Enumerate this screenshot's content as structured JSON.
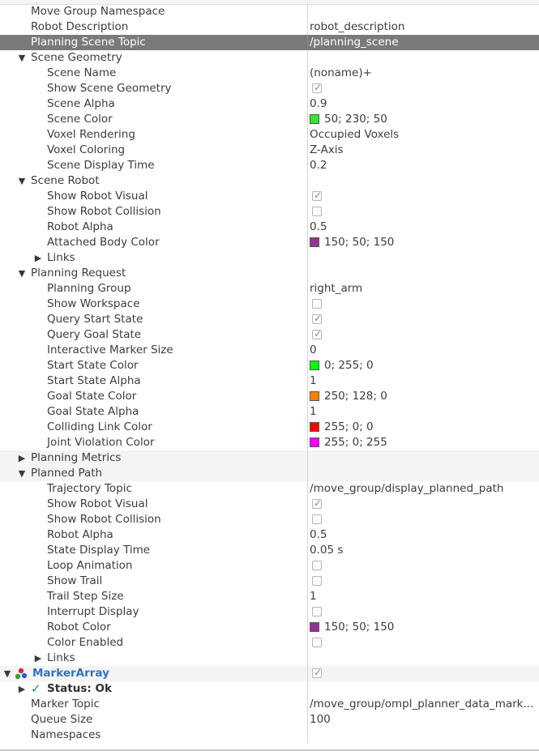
{
  "rows": [
    {
      "kind": "prop",
      "depth": 2,
      "name": "Move Group Namespace",
      "val": {
        "t": "text",
        "text": ""
      },
      "alt": false
    },
    {
      "kind": "prop",
      "depth": 2,
      "name": "Robot Description",
      "val": {
        "t": "text",
        "text": "robot_description"
      },
      "alt": false
    },
    {
      "kind": "prop",
      "depth": 2,
      "name": "Planning Scene Topic",
      "val": {
        "t": "text",
        "text": "/planning_scene"
      },
      "selected": true
    },
    {
      "kind": "group",
      "depth": 1,
      "expanded": true,
      "name": "Scene Geometry",
      "val": {
        "t": "none"
      },
      "alt": false
    },
    {
      "kind": "prop",
      "depth": 3,
      "name": "Scene Name",
      "val": {
        "t": "text",
        "text": "(noname)+"
      },
      "alt": false
    },
    {
      "kind": "prop",
      "depth": 3,
      "name": "Show Scene Geometry",
      "val": {
        "t": "check",
        "checked": true
      },
      "alt": false
    },
    {
      "kind": "prop",
      "depth": 3,
      "name": "Scene Alpha",
      "val": {
        "t": "text",
        "text": "0.9"
      },
      "alt": false
    },
    {
      "kind": "prop",
      "depth": 3,
      "name": "Scene Color",
      "val": {
        "t": "color",
        "color": "#32e632",
        "text": "50; 230; 50"
      },
      "alt": false
    },
    {
      "kind": "prop",
      "depth": 3,
      "name": "Voxel Rendering",
      "val": {
        "t": "text",
        "text": "Occupied Voxels"
      },
      "alt": false
    },
    {
      "kind": "prop",
      "depth": 3,
      "name": "Voxel Coloring",
      "val": {
        "t": "text",
        "text": "Z-Axis"
      },
      "alt": false
    },
    {
      "kind": "prop",
      "depth": 3,
      "name": "Scene Display Time",
      "val": {
        "t": "text",
        "text": "0.2"
      },
      "alt": false
    },
    {
      "kind": "group",
      "depth": 1,
      "expanded": true,
      "name": "Scene Robot",
      "val": {
        "t": "none"
      },
      "alt": false
    },
    {
      "kind": "prop",
      "depth": 3,
      "name": "Show Robot Visual",
      "val": {
        "t": "check",
        "checked": true
      },
      "alt": false
    },
    {
      "kind": "prop",
      "depth": 3,
      "name": "Show Robot Collision",
      "val": {
        "t": "check",
        "checked": false
      },
      "alt": false
    },
    {
      "kind": "prop",
      "depth": 3,
      "name": "Robot Alpha",
      "val": {
        "t": "text",
        "text": "0.5"
      },
      "alt": false
    },
    {
      "kind": "prop",
      "depth": 3,
      "name": "Attached Body Color",
      "val": {
        "t": "color",
        "color": "#963296",
        "text": "150; 50; 150"
      },
      "alt": false
    },
    {
      "kind": "group",
      "depth": 2,
      "expanded": false,
      "name": "Links",
      "val": {
        "t": "none"
      },
      "alt": false
    },
    {
      "kind": "group",
      "depth": 1,
      "expanded": true,
      "name": "Planning Request",
      "val": {
        "t": "none"
      },
      "alt": false
    },
    {
      "kind": "prop",
      "depth": 3,
      "name": "Planning Group",
      "val": {
        "t": "text",
        "text": "right_arm"
      },
      "alt": false
    },
    {
      "kind": "prop",
      "depth": 3,
      "name": "Show Workspace",
      "val": {
        "t": "check",
        "checked": false
      },
      "alt": false
    },
    {
      "kind": "prop",
      "depth": 3,
      "name": "Query Start State",
      "val": {
        "t": "check",
        "checked": true
      },
      "alt": false
    },
    {
      "kind": "prop",
      "depth": 3,
      "name": "Query Goal State",
      "val": {
        "t": "check",
        "checked": true
      },
      "alt": false
    },
    {
      "kind": "prop",
      "depth": 3,
      "name": "Interactive Marker Size",
      "val": {
        "t": "text",
        "text": "0"
      },
      "alt": false
    },
    {
      "kind": "prop",
      "depth": 3,
      "name": "Start State Color",
      "val": {
        "t": "color",
        "color": "#00ff00",
        "text": "0; 255; 0"
      },
      "alt": false
    },
    {
      "kind": "prop",
      "depth": 3,
      "name": "Start State Alpha",
      "val": {
        "t": "text",
        "text": "1"
      },
      "alt": false
    },
    {
      "kind": "prop",
      "depth": 3,
      "name": "Goal State Color",
      "val": {
        "t": "color",
        "color": "#fa8000",
        "text": "250; 128; 0"
      },
      "alt": false
    },
    {
      "kind": "prop",
      "depth": 3,
      "name": "Goal State Alpha",
      "val": {
        "t": "text",
        "text": "1"
      },
      "alt": false
    },
    {
      "kind": "prop",
      "depth": 3,
      "name": "Colliding Link Color",
      "val": {
        "t": "color",
        "color": "#ff0000",
        "text": "255; 0; 0"
      },
      "alt": false
    },
    {
      "kind": "prop",
      "depth": 3,
      "name": "Joint Violation Color",
      "val": {
        "t": "color",
        "color": "#ff00ff",
        "text": "255; 0; 255"
      },
      "alt": false
    },
    {
      "kind": "group",
      "depth": 1,
      "expanded": false,
      "name": "Planning Metrics",
      "val": {
        "t": "none"
      },
      "alt": true
    },
    {
      "kind": "group",
      "depth": 1,
      "expanded": true,
      "name": "Planned Path",
      "val": {
        "t": "none"
      },
      "alt": true
    },
    {
      "kind": "prop",
      "depth": 3,
      "name": "Trajectory Topic",
      "val": {
        "t": "text",
        "text": "/move_group/display_planned_path"
      },
      "alt": false
    },
    {
      "kind": "prop",
      "depth": 3,
      "name": "Show Robot Visual",
      "val": {
        "t": "check",
        "checked": true
      },
      "alt": false
    },
    {
      "kind": "prop",
      "depth": 3,
      "name": "Show Robot Collision",
      "val": {
        "t": "check",
        "checked": false
      },
      "alt": false
    },
    {
      "kind": "prop",
      "depth": 3,
      "name": "Robot Alpha",
      "val": {
        "t": "text",
        "text": "0.5"
      },
      "alt": false
    },
    {
      "kind": "prop",
      "depth": 3,
      "name": "State Display Time",
      "val": {
        "t": "text",
        "text": "0.05 s"
      },
      "alt": false
    },
    {
      "kind": "prop",
      "depth": 3,
      "name": "Loop Animation",
      "val": {
        "t": "check",
        "checked": false
      },
      "alt": false
    },
    {
      "kind": "prop",
      "depth": 3,
      "name": "Show Trail",
      "val": {
        "t": "check",
        "checked": false
      },
      "alt": false
    },
    {
      "kind": "prop",
      "depth": 3,
      "name": "Trail Step Size",
      "val": {
        "t": "text",
        "text": "1"
      },
      "alt": false
    },
    {
      "kind": "prop",
      "depth": 3,
      "name": "Interrupt Display",
      "val": {
        "t": "check",
        "checked": false
      },
      "alt": false
    },
    {
      "kind": "prop",
      "depth": 3,
      "name": "Robot Color",
      "val": {
        "t": "color",
        "color": "#963296",
        "text": "150; 50; 150"
      },
      "alt": false
    },
    {
      "kind": "prop",
      "depth": 3,
      "name": "Color Enabled",
      "val": {
        "t": "check",
        "checked": false
      },
      "alt": false
    },
    {
      "kind": "group",
      "depth": 2,
      "expanded": false,
      "name": "Links",
      "val": {
        "t": "none"
      },
      "alt": false
    },
    {
      "kind": "display",
      "depth": 0,
      "expanded": true,
      "name": "MarkerArray",
      "icon": "marker-array-icon",
      "val": {
        "t": "check",
        "checked": true
      },
      "alt": true
    },
    {
      "kind": "status",
      "depth": 1,
      "expanded": false,
      "name": "Status: Ok",
      "icon": "checkmark-icon",
      "val": {
        "t": "none"
      },
      "alt": false
    },
    {
      "kind": "prop",
      "depth": 2,
      "name": "Marker Topic",
      "val": {
        "t": "text",
        "text": "/move_group/ompl_planner_data_mark..."
      },
      "alt": false
    },
    {
      "kind": "prop",
      "depth": 2,
      "name": "Queue Size",
      "val": {
        "t": "text",
        "text": "100"
      },
      "alt": false
    },
    {
      "kind": "prop",
      "depth": 2,
      "name": "Namespaces",
      "val": {
        "t": "none"
      },
      "alt": false
    }
  ],
  "colors": {
    "accent": "#2f72c4",
    "selection": "#7a7a7a",
    "status_ok": "#2e8b2e"
  }
}
